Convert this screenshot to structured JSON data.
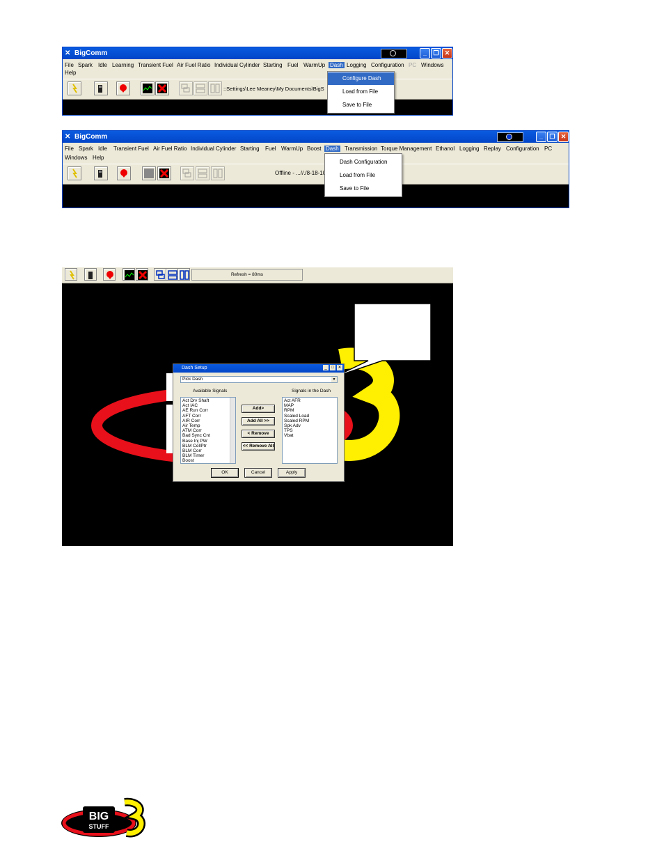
{
  "window1": {
    "title": "BigComm",
    "menu": [
      "File",
      "Spark",
      "Idle",
      "Learning",
      "Transient Fuel",
      "Air Fuel Ratio",
      "Individual Cylinder",
      "Starting",
      "Fuel",
      "WarmUp",
      "Dash",
      "Logging",
      "Configuration",
      "PC",
      "Windows",
      "Help"
    ],
    "path": "::Settings\\Lee Meaney\\My Documents\\BigS",
    "dash_menu": [
      "Configure Dash",
      "Load from File",
      "Save to File"
    ]
  },
  "window2": {
    "title": "BigComm",
    "menu": [
      "File",
      "Spark",
      "Idle",
      "Transient Fuel",
      "Air Fuel Ratio",
      "Individual Cylinder",
      "Starting",
      "Fuel",
      "WarmUp",
      "Boost",
      "Dash",
      "Transmission",
      "Torque Management",
      "Ethanol",
      "Logging",
      "Replay",
      "Configuration",
      "PC",
      "Windows",
      "Help"
    ],
    "status": "Offline - ...//./8-18-10",
    "dash_menu": [
      "Dash Configuration",
      "Load from File",
      "Save to File"
    ]
  },
  "window3": {
    "refresh": "Refresh = 80ms"
  },
  "dash_setup": {
    "title": "Dash Setup",
    "pick_dash": "Pick Dash",
    "available_label": "Available Signals",
    "in_dash_label": "Signals in the Dash",
    "available": [
      "Act Drv Shaft",
      "Act IAC",
      "AE Run Corr",
      "AFT Corr",
      "AIR Corr",
      "Air Temp",
      "ATM Corr",
      "Bad Sync Cnt",
      "Base Inj PW",
      "BLM CellPtr",
      "BLM Corr",
      "BLM Timer",
      "Boost"
    ],
    "in_dash": [
      "Act AFR",
      "MAP",
      "RPM",
      "Scaled Load",
      "Scaled RPM",
      "Spk Adv",
      "TPS",
      "Vbat"
    ],
    "buttons": {
      "add": "Add>",
      "add_all": "Add All >>",
      "remove": "< Remove",
      "remove_all": "<< Remove All"
    },
    "ok": "OK",
    "cancel": "Cancel",
    "apply": "Apply"
  },
  "colors": {
    "xp_blue": "#0245c8",
    "xp_face": "#ece9d8",
    "highlight": "#316ac5",
    "logo_red": "#e8101a",
    "logo_yellow": "#ffef00"
  }
}
